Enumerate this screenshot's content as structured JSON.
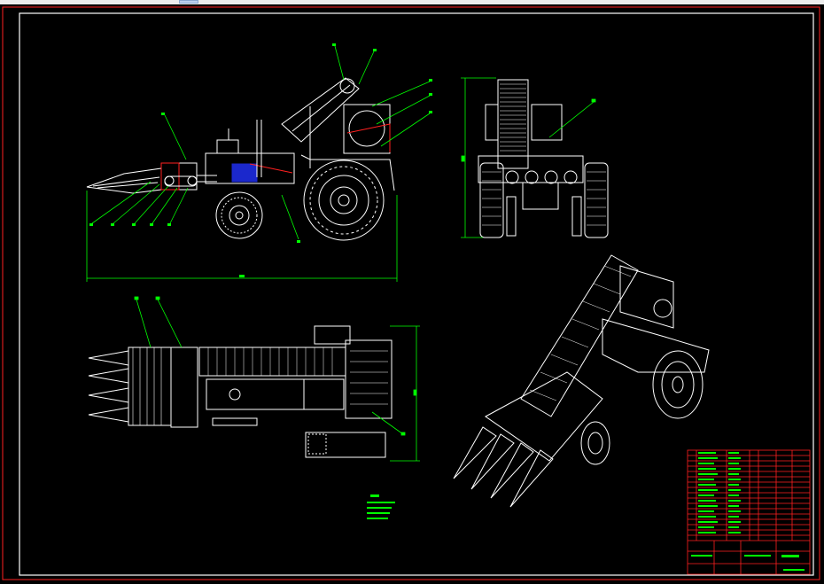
{
  "app": {
    "canvas_background": "#000000",
    "toolbar_color": "#ececec"
  },
  "colors": {
    "frame": "#ff2020",
    "outline": "#ffffff",
    "dimension": "#00ff00",
    "accent_blue": "#2233ff",
    "accent_red": "#ff2020",
    "title_grid": "#ff2020",
    "notes": "#00ff00"
  },
  "drawing": {
    "views": [
      "side-elevation",
      "rear-elevation",
      "top-plan",
      "isometric"
    ],
    "title_block_rows": 18,
    "notes_lines": 5
  },
  "icons": {
    "active_tab": "toolbar-tab-icon"
  }
}
